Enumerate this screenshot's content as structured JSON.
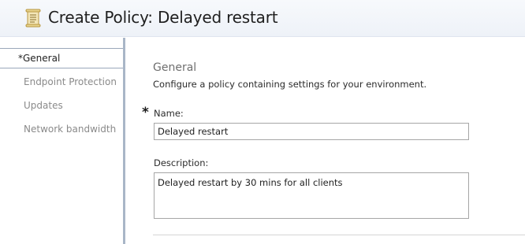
{
  "header": {
    "title": "Create Policy: Delayed restart",
    "icon": "policy-scroll-icon"
  },
  "sidebar": {
    "items": [
      {
        "label": "*General",
        "selected": true
      },
      {
        "label": "Endpoint Protection",
        "selected": false
      },
      {
        "label": "Updates",
        "selected": false
      },
      {
        "label": "Network bandwidth",
        "selected": false
      }
    ]
  },
  "main": {
    "section_title": "General",
    "section_description": "Configure a policy containing settings for your environment.",
    "required_marker": "*",
    "name_label": "Name:",
    "name_value": "Delayed restart",
    "description_label": "Description:",
    "description_value": "Delayed restart by 30 mins for all clients"
  },
  "colors": {
    "header_background": "#eef2f8",
    "sidebar_divider": "#a9b6c7",
    "muted_text": "#8a8a8a"
  }
}
